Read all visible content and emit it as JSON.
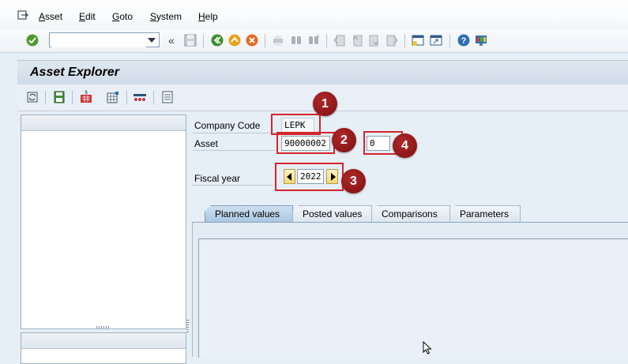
{
  "menu": {
    "items": [
      {
        "label": "Asset",
        "accel": "A"
      },
      {
        "label": "Edit",
        "accel": "E"
      },
      {
        "label": "Goto",
        "accel": "G"
      },
      {
        "label": "System",
        "accel": "S"
      },
      {
        "label": "Help",
        "accel": "H"
      }
    ]
  },
  "toolbar": {
    "command_field_value": "",
    "expand_glyph": "«"
  },
  "title": "Asset Explorer",
  "form": {
    "company_code_label": "Company Code",
    "company_code_value": "LEPK",
    "asset_label": "Asset",
    "asset_value": "90000002",
    "subnumber_value": "0",
    "fiscal_year_label": "Fiscal year",
    "fiscal_year_value": "2022"
  },
  "tabs": [
    {
      "label": "Planned values",
      "active": true
    },
    {
      "label": "Posted values",
      "active": false
    },
    {
      "label": "Comparisons",
      "active": false
    },
    {
      "label": "Parameters",
      "active": false
    }
  ],
  "callouts": [
    "1",
    "2",
    "3",
    "4"
  ],
  "colors": {
    "callout_red": "#d3262b",
    "badge_red": "#9a1a1c",
    "active_tab": "#b9d2e8",
    "background": "#e6eef6"
  },
  "icons": [
    "exit-icon",
    "enter-check-icon",
    "save-icon",
    "back-icon",
    "exit-yellow-icon",
    "cancel-icon",
    "print-icon",
    "find-icon",
    "find-next-icon",
    "first-page-icon",
    "previous-page-icon",
    "next-page-icon",
    "last-page-icon",
    "create-session-icon",
    "shortcut-icon",
    "help-icon",
    "customize-layout-icon",
    "refresh-icon",
    "save-layout-icon",
    "calculator-icon",
    "table-icon",
    "chain-icon",
    "list-icon"
  ]
}
